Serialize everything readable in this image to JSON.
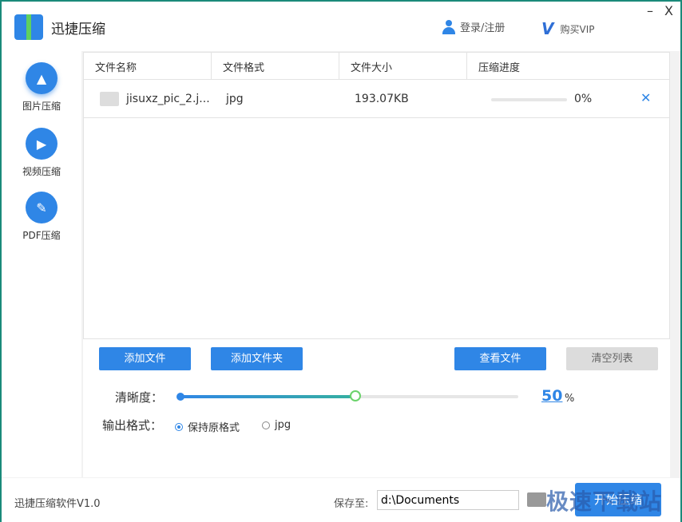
{
  "app": {
    "title": "迅捷压缩",
    "login": "登录/注册",
    "vip": "购买VIP",
    "minimize": "–",
    "close": "X"
  },
  "sidebar": {
    "items": [
      {
        "label": "图片压缩",
        "icon": "image-icon",
        "active": true
      },
      {
        "label": "视频压缩",
        "icon": "play-icon"
      },
      {
        "label": "PDF压缩",
        "icon": "pdf-icon"
      }
    ]
  },
  "table": {
    "headers": [
      "文件名称",
      "文件格式",
      "文件大小",
      "压缩进度"
    ],
    "rows": [
      {
        "name": "jisuxz_pic_2.j...",
        "format": "jpg",
        "size": "193.07KB",
        "progress": "0%",
        "remove": "✕"
      }
    ]
  },
  "controls": {
    "add_file": "添加文件",
    "add_folder": "添加文件夹",
    "view_files": "查看文件",
    "clear_list": "清空列表",
    "clarity_label": "清晰度：",
    "clarity_value": "50",
    "clarity_unit": "%",
    "format_label": "输出格式：",
    "format_options": [
      "保持原格式",
      "jpg"
    ],
    "format_selected": "保持原格式"
  },
  "footer": {
    "version": "迅捷压缩软件V1.0",
    "save_label": "保存至:",
    "save_path": "d:\\Documents",
    "start": "开始压缩",
    "watermark": "极速下载站"
  },
  "colors": {
    "accent": "#2f86e6",
    "border": "#1a8a7a"
  }
}
